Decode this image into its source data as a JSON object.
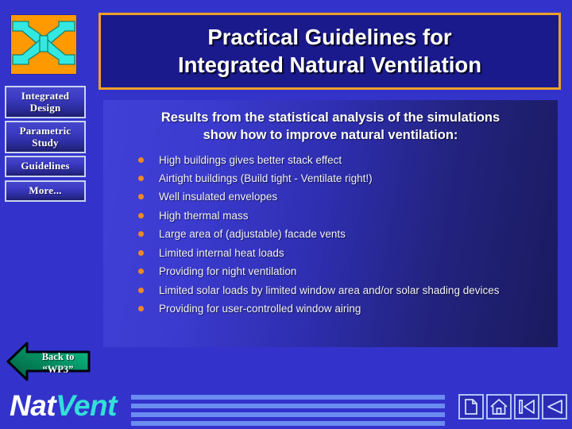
{
  "slide": {
    "title": "Practical Guidelines for\nIntegrated Natural Ventilation",
    "background_color": "#3333cc",
    "title_border_color": "#f0a028",
    "bullet_color": "#ee8822"
  },
  "logo": {
    "name": "converging-arrows-logo",
    "background_color": "#ff9900",
    "arrow_color": "#33e8e0"
  },
  "sidebar": {
    "items": [
      {
        "label": "Integrated\nDesign",
        "name": "integrated-design"
      },
      {
        "label": "Parametric\nStudy",
        "name": "parametric-study"
      },
      {
        "label": "Guidelines",
        "name": "guidelines"
      },
      {
        "label": "More...",
        "name": "more"
      }
    ]
  },
  "content": {
    "heading": "Results from the statistical analysis of the simulations\nshow how to improve natural ventilation:",
    "bullets": [
      "High buildings gives better stack effect",
      "Airtight buildings (Build tight - Ventilate right!)",
      "Well insulated envelopes",
      "High thermal mass",
      "Large area of (adjustable) facade vents",
      "Limited internal heat loads",
      "Providing for night ventilation",
      "Limited solar loads by limited window area and/or solar shading devices",
      "Providing for user-controlled window airing"
    ]
  },
  "back_arrow": {
    "label": "Back  to\n“WP3”",
    "fill_color": "#00a870"
  },
  "footer": {
    "logo_part1": "Nat",
    "logo_part2": "Vent",
    "logo_part1_color": "#ffffff",
    "logo_part2_color": "#33e0d8",
    "stripe_color": "#6b8cf0",
    "nav_icons": [
      {
        "name": "document-icon",
        "title": "Document"
      },
      {
        "name": "home-icon",
        "title": "Home"
      },
      {
        "name": "first-slide-icon",
        "title": "First"
      },
      {
        "name": "previous-slide-icon",
        "title": "Previous"
      }
    ]
  }
}
